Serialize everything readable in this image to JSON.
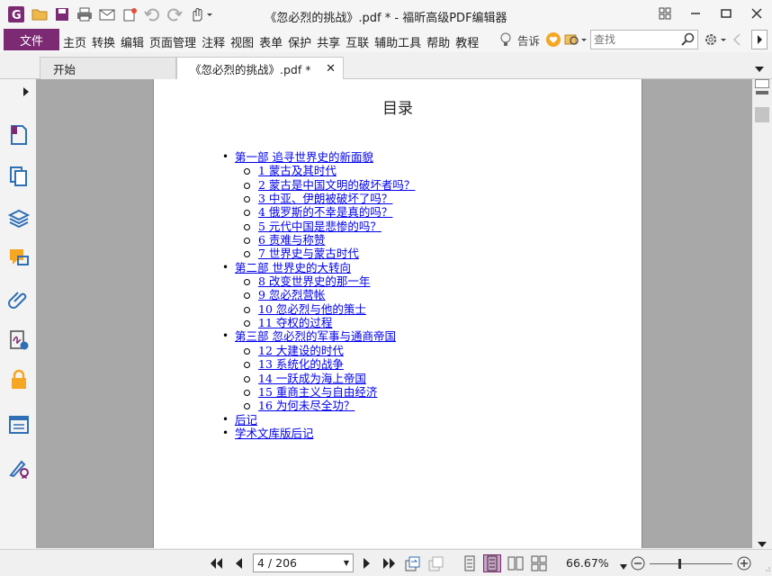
{
  "window": {
    "title": "《忽必烈的挑战》.pdf * - 福昕高级PDF编辑器"
  },
  "quick_access": {
    "icons": [
      "open-folder-icon",
      "save-icon",
      "print-icon",
      "email-icon",
      "new-icon",
      "undo-icon",
      "redo-icon",
      "hand-tool-icon"
    ]
  },
  "menu": {
    "file": "文件",
    "items": [
      "主页",
      "转换",
      "编辑",
      "页面管理",
      "注释",
      "视图",
      "表单",
      "保护",
      "共享",
      "互联",
      "辅助工具",
      "帮助",
      "教程"
    ],
    "tell_me": "告诉",
    "search_placeholder": "查找"
  },
  "tabs": [
    {
      "label": "开始"
    },
    {
      "label": "《忽必烈的挑战》.pdf *"
    }
  ],
  "document": {
    "heading": "目录",
    "toc": [
      {
        "level": "part",
        "text": "第一部 追寻世界史的新面貌"
      },
      {
        "level": "chapter",
        "text": "1 蒙古及其时代"
      },
      {
        "level": "chapter",
        "text": "2 蒙古是中国文明的破坏者吗？"
      },
      {
        "level": "chapter",
        "text": "3 中亚、伊朗被破坏了吗？"
      },
      {
        "level": "chapter",
        "text": "4 俄罗斯的不幸是真的吗？"
      },
      {
        "level": "chapter",
        "text": "5 元代中国是悲惨的吗？"
      },
      {
        "level": "chapter",
        "text": "6 责难与称赞"
      },
      {
        "level": "chapter",
        "text": "7 世界史与蒙古时代"
      },
      {
        "level": "part",
        "text": "第二部 世界史的大转向"
      },
      {
        "level": "chapter",
        "text": "8 改变世界史的那一年"
      },
      {
        "level": "chapter",
        "text": "9 忽必烈营帐"
      },
      {
        "level": "chapter",
        "text": "10 忽必烈与他的策士"
      },
      {
        "level": "chapter",
        "text": "11 夺权的过程"
      },
      {
        "level": "part",
        "text": "第三部 忽必烈的军事与通商帝国"
      },
      {
        "level": "chapter",
        "text": "12 大建设的时代"
      },
      {
        "level": "chapter",
        "text": "13 系统化的战争"
      },
      {
        "level": "chapter",
        "text": "14 一跃成为海上帝国"
      },
      {
        "level": "chapter",
        "text": "15 重商主义与自由经济"
      },
      {
        "level": "chapter",
        "text": "16 为何未尽全功？"
      },
      {
        "level": "part",
        "text": "后记"
      },
      {
        "level": "part",
        "text": "学术文库版后记"
      }
    ]
  },
  "status": {
    "page_indicator": "4 / 206",
    "zoom": "66.67%",
    "zoom_slider_level": 0.35
  },
  "colors": {
    "brand": "#7b2a73",
    "link": "#0000ee",
    "canvas_bg": "#a8a8a8",
    "accent_icon": "#f5a623",
    "sidebar_icon": "#2f6fb5"
  }
}
